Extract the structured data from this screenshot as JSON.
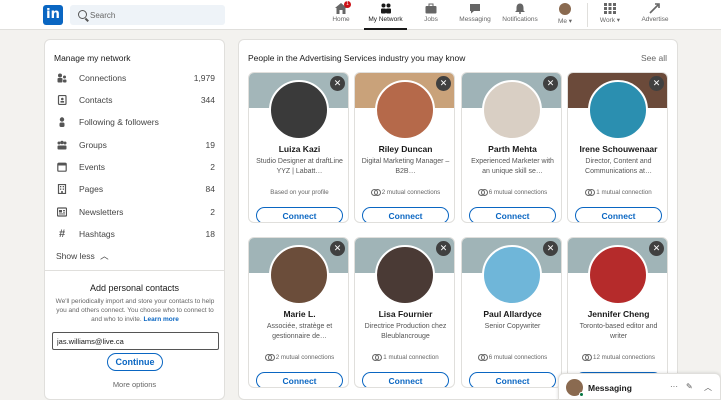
{
  "nav": {
    "logo": "in",
    "search_placeholder": "Search",
    "items": [
      {
        "label": "Home",
        "icon": "home-icon"
      },
      {
        "label": "My Network",
        "icon": "network-icon"
      },
      {
        "label": "Jobs",
        "icon": "briefcase-icon"
      },
      {
        "label": "Messaging",
        "icon": "messaging-icon"
      },
      {
        "label": "Notifications",
        "icon": "bell-icon"
      },
      {
        "label": "Me",
        "icon": "avatar"
      },
      {
        "label": "Work",
        "icon": "grid-icon"
      },
      {
        "label": "Advertise",
        "icon": "advertise-icon"
      }
    ],
    "home_badge": "1",
    "active": "My Network"
  },
  "sidebar": {
    "title": "Manage my network",
    "items": [
      {
        "label": "Connections",
        "count": "1,979",
        "icon": "people-icon"
      },
      {
        "label": "Contacts",
        "count": "344",
        "icon": "contact-book-icon"
      },
      {
        "label": "Following & followers",
        "count": "",
        "icon": "person-icon"
      },
      {
        "label": "Groups",
        "count": "19",
        "icon": "groups-icon"
      },
      {
        "label": "Events",
        "count": "2",
        "icon": "calendar-icon"
      },
      {
        "label": "Pages",
        "count": "84",
        "icon": "building-icon"
      },
      {
        "label": "Newsletters",
        "count": "2",
        "icon": "newspaper-icon"
      },
      {
        "label": "Hashtags",
        "count": "18",
        "icon": "hashtag-icon"
      }
    ],
    "show_less": "Show less",
    "add_contacts": {
      "title": "Add personal contacts",
      "description": "We'll periodically import and store your contacts to help you and others connect. You choose who to connect to and who to invite.",
      "learn_more": "Learn more",
      "email_value": "jas.williams@live.ca",
      "continue_label": "Continue",
      "more_options": "More options"
    }
  },
  "main": {
    "title": "People in the Advertising Services industry you may know",
    "see_all": "See all",
    "connect_label": "Connect",
    "people": [
      {
        "name": "Luiza Kazi",
        "headline": "Studio Designer at draftLine YYZ | Labatt…",
        "meta": "Based on your profile",
        "mutual": false,
        "banner": "#a3b6b9",
        "avatar": "#3a3a3a"
      },
      {
        "name": "Riley Duncan",
        "headline": "Digital Marketing Manager – B2B…",
        "meta": "2 mutual connections",
        "mutual": true,
        "banner": "#c9a27a",
        "avatar": "#b5694a"
      },
      {
        "name": "Parth Mehta",
        "headline": "Experienced Marketer with an unique skill se…",
        "meta": "6 mutual connections",
        "mutual": true,
        "banner": "#9fb3b7",
        "avatar": "#d9cfc4"
      },
      {
        "name": "Irene Schouwenaar",
        "headline": "Director, Content and Communications at…",
        "meta": "1 mutual connection",
        "mutual": true,
        "banner": "#6b4a3a",
        "avatar": "#2b8fb0"
      },
      {
        "name": "Marie L.",
        "headline": "Associée, stratège et gestionnaire de…",
        "meta": "2 mutual connections",
        "mutual": true,
        "banner": "#a0b4b7",
        "avatar": "#6b4d3a"
      },
      {
        "name": "Lisa Fournier",
        "headline": "Directrice Production chez Bleublancrouge",
        "meta": "1 mutual connection",
        "mutual": true,
        "banner": "#a0b4b7",
        "avatar": "#4a3a35"
      },
      {
        "name": "Paul Allardyce",
        "headline": "Senior Copywriter",
        "meta": "6 mutual connections",
        "mutual": true,
        "banner": "#a0b4b7",
        "avatar": "#6fb6d9"
      },
      {
        "name": "Jennifer Cheng",
        "headline": "Toronto-based editor and writer",
        "meta": "12 mutual connections",
        "mutual": true,
        "banner": "#a0b4b7",
        "avatar": "#b52b2b"
      }
    ]
  },
  "messaging": {
    "label": "Messaging"
  },
  "colors": {
    "brand": "#0a66c2",
    "background": "#f3f2ef",
    "badge": "#cc1016"
  }
}
